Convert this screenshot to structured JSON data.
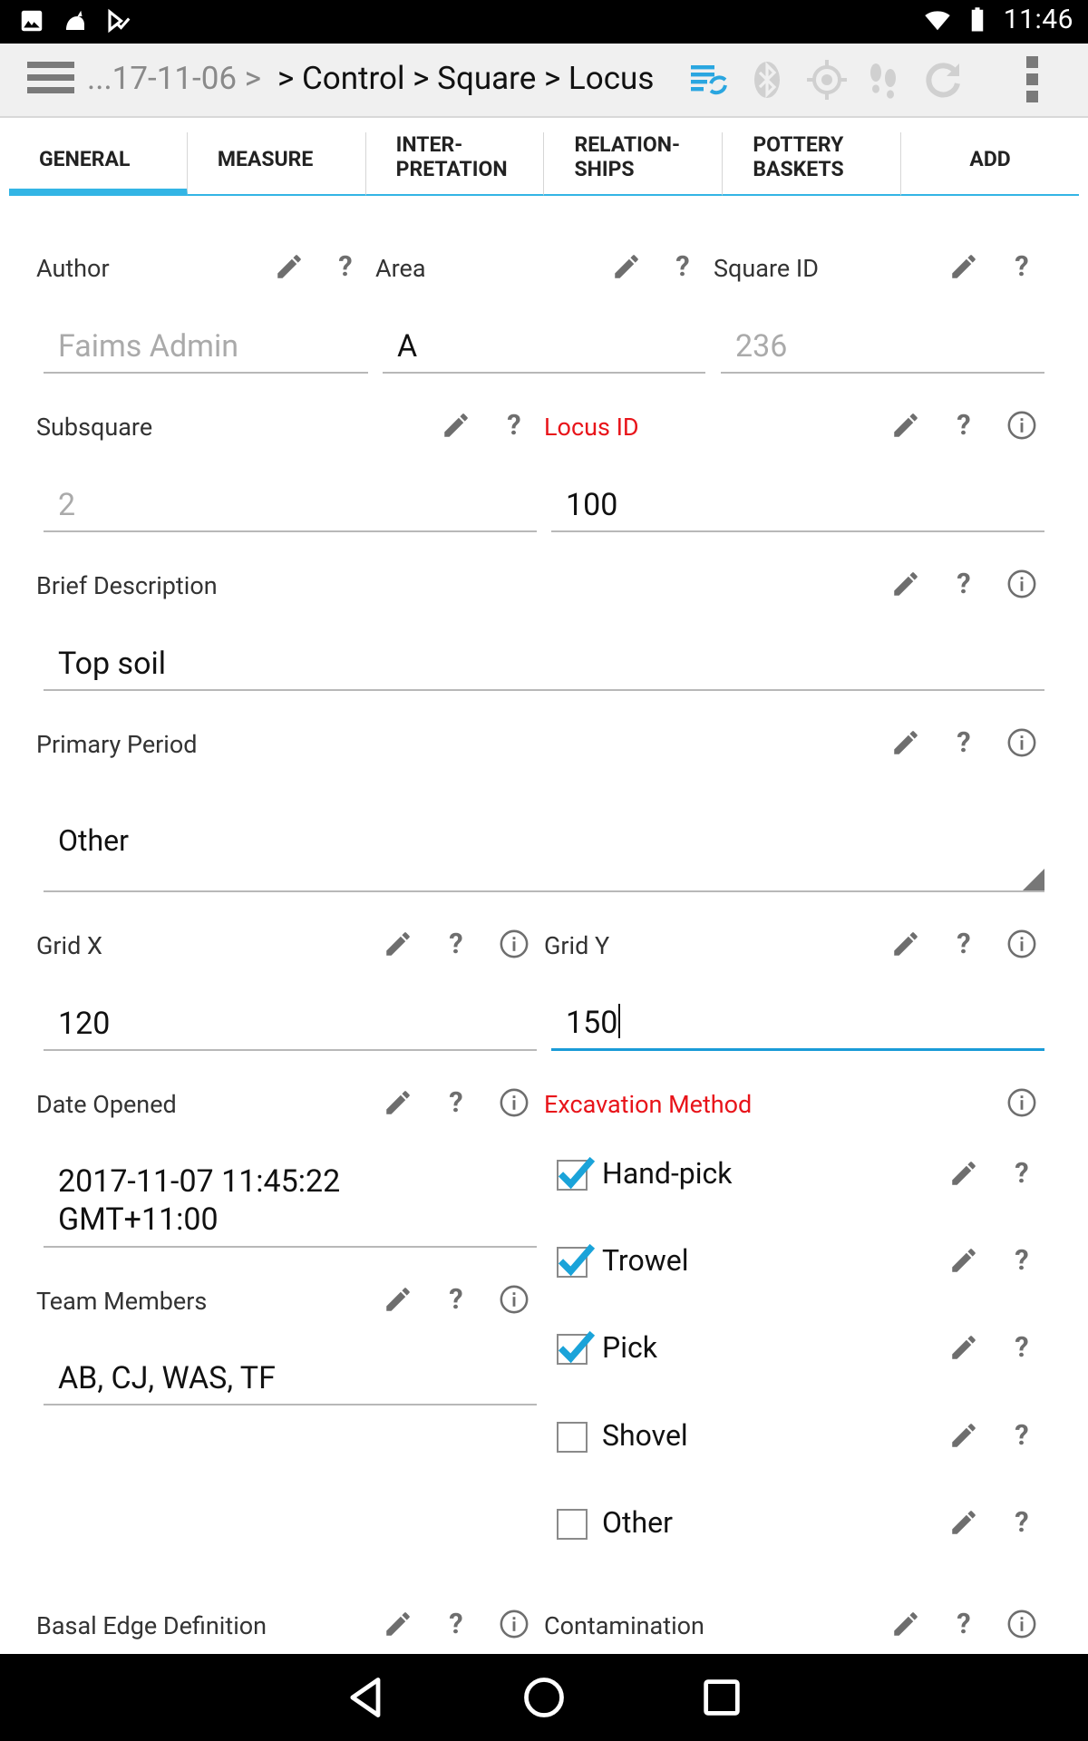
{
  "status_bar": {
    "time": "11:46",
    "left_icons": [
      "image-icon",
      "cat-icon",
      "download-done-icon"
    ],
    "right_icons": [
      "wifi-icon",
      "battery-icon"
    ]
  },
  "action_bar": {
    "breadcrumb_prefix": "...17-11-06 >",
    "breadcrumb_main": "> Control > Square > Locus",
    "icons": [
      "sync-list-icon",
      "bluetooth-icon",
      "gps-icon",
      "footsteps-icon",
      "refresh-icon"
    ]
  },
  "tabs": [
    {
      "label": "GENERAL",
      "active": true
    },
    {
      "label": "MEASURE",
      "active": false
    },
    {
      "label": "INTER-\nPRETATION",
      "active": false
    },
    {
      "label": "RELATION-\nSHIPS",
      "active": false
    },
    {
      "label": "POTTERY\nBASKETS",
      "active": false
    },
    {
      "label": "ADD",
      "active": false
    }
  ],
  "fields": {
    "author": {
      "label": "Author",
      "value": "Faims Admin"
    },
    "area": {
      "label": "Area",
      "value": "A"
    },
    "square_id": {
      "label": "Square ID",
      "value": "236"
    },
    "subsquare": {
      "label": "Subsquare",
      "value": "2"
    },
    "locus_id": {
      "label": "Locus ID",
      "value": "100"
    },
    "brief_description": {
      "label": "Brief Description",
      "value": "Top soil"
    },
    "primary_period": {
      "label": "Primary Period",
      "value": "Other"
    },
    "grid_x": {
      "label": "Grid X",
      "value": "120"
    },
    "grid_y": {
      "label": "Grid Y",
      "value": "150"
    },
    "date_opened": {
      "label": "Date Opened",
      "value": "2017-11-07 11:45:22\nGMT+11:00"
    },
    "team_members": {
      "label": "Team Members",
      "value": "AB, CJ, WAS, TF"
    },
    "excavation_method": {
      "label": "Excavation Method",
      "options": [
        {
          "label": "Hand-pick",
          "checked": true
        },
        {
          "label": "Trowel",
          "checked": true
        },
        {
          "label": "Pick",
          "checked": true
        },
        {
          "label": "Shovel",
          "checked": false
        },
        {
          "label": "Other",
          "checked": false
        }
      ]
    },
    "basal_edge_definition": {
      "label": "Basal Edge Definition"
    },
    "contamination": {
      "label": "Contamination"
    }
  },
  "help_glyph": "?",
  "colors": {
    "accent": "#33b5e5",
    "required": "#e8141a",
    "focus": "#1a9bd7"
  }
}
